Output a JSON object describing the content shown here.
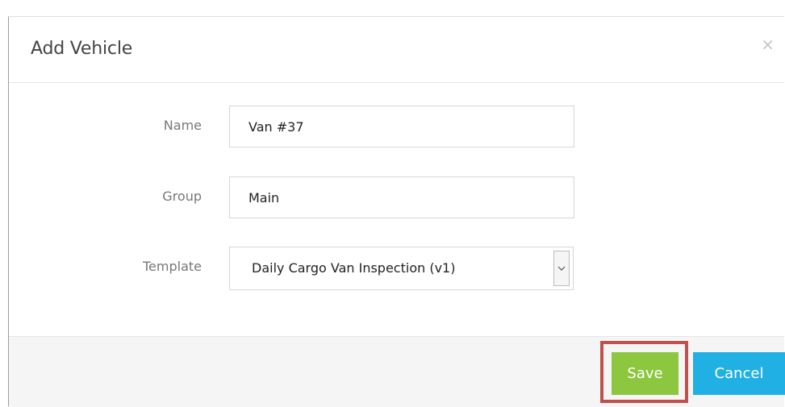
{
  "dialog": {
    "title": "Add Vehicle",
    "close_label": "×"
  },
  "form": {
    "name": {
      "label": "Name",
      "value": "Van #37"
    },
    "group": {
      "label": "Group",
      "value": "Main"
    },
    "template": {
      "label": "Template",
      "selected": "Daily Cargo Van Inspection (v1)"
    }
  },
  "footer": {
    "save_label": "Save",
    "cancel_label": "Cancel"
  },
  "colors": {
    "save": "#8dc63f",
    "cancel": "#21b0e3",
    "highlight": "#c0504d"
  }
}
